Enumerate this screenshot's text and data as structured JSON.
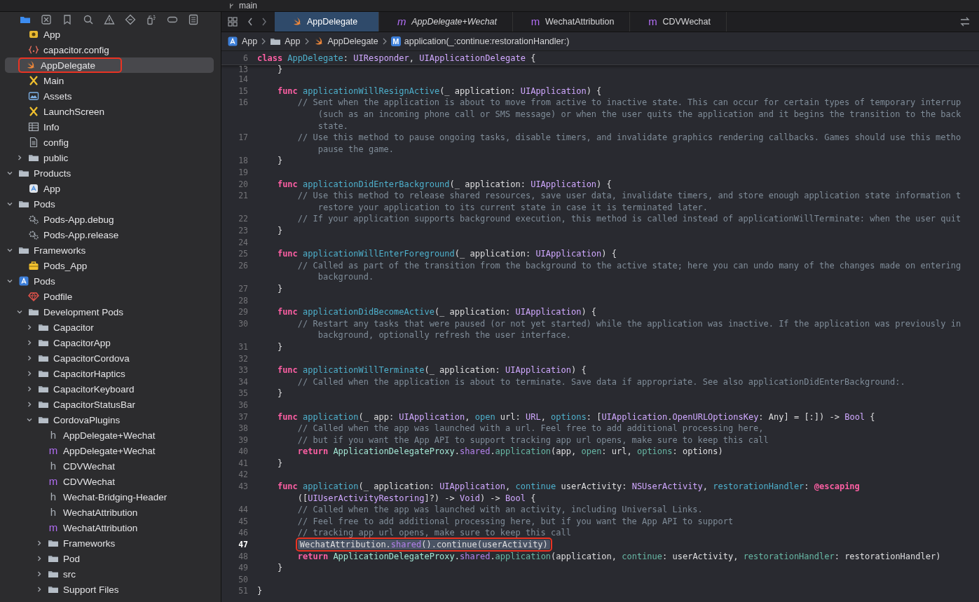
{
  "top_strip": {
    "branch": "main"
  },
  "navigator_tabs": [
    {
      "kind": "folder",
      "selected": true
    },
    {
      "kind": "square-x",
      "selected": false
    },
    {
      "kind": "bookmark",
      "selected": false
    },
    {
      "kind": "search",
      "selected": false
    },
    {
      "kind": "warning",
      "selected": false
    },
    {
      "kind": "diamond",
      "selected": false
    },
    {
      "kind": "spray",
      "selected": false
    },
    {
      "kind": "capsule",
      "selected": false
    },
    {
      "kind": "list",
      "selected": false
    }
  ],
  "tree": [
    {
      "children": [
        {
          "children": [
            {
              "label": "App",
              "kind": "appgroup",
              "selected": false,
              "marked": false
            },
            {
              "label": "capacitor.config",
              "kind": "config",
              "selected": false,
              "marked": false
            },
            {
              "label": "AppDelegate",
              "kind": "swift",
              "selected": true,
              "marked": true
            },
            {
              "label": "Main",
              "kind": "storyboard",
              "selected": false,
              "marked": false
            },
            {
              "label": "Assets",
              "kind": "assets",
              "selected": false,
              "marked": false
            },
            {
              "label": "LaunchScreen",
              "kind": "storyboard",
              "selected": false,
              "marked": false
            },
            {
              "label": "Info",
              "kind": "plist",
              "selected": false,
              "marked": false
            },
            {
              "label": "config",
              "kind": "file",
              "selected": false,
              "marked": false
            },
            {
              "label": "public",
              "kind": "folder",
              "expanded": false,
              "selected": false,
              "marked": false
            }
          ]
        },
        {
          "label": "Products",
          "kind": "folder",
          "expanded": true,
          "selected": false,
          "marked": false,
          "children": [
            {
              "label": "App",
              "kind": "app",
              "selected": false,
              "marked": false
            }
          ]
        },
        {
          "label": "Pods",
          "kind": "folder",
          "expanded": true,
          "selected": false,
          "marked": false,
          "children": [
            {
              "label": "Pods-App.debug",
              "kind": "xcconfig",
              "selected": false,
              "marked": false
            },
            {
              "label": "Pods-App.release",
              "kind": "xcconfig",
              "selected": false,
              "marked": false
            }
          ]
        },
        {
          "label": "Frameworks",
          "kind": "folder",
          "expanded": true,
          "selected": false,
          "marked": false,
          "children": [
            {
              "label": "Pods_App",
              "kind": "framework",
              "selected": false,
              "marked": false
            }
          ]
        }
      ]
    },
    {
      "label": "Pods",
      "kind": "project",
      "expanded": true,
      "selected": false,
      "marked": false,
      "children": [
        {
          "label": "Podfile",
          "kind": "gem",
          "selected": false,
          "marked": false
        },
        {
          "label": "Development Pods",
          "kind": "folder",
          "expanded": true,
          "selected": false,
          "marked": false,
          "children": [
            {
              "label": "Capacitor",
              "kind": "folder",
              "expanded": false,
              "selected": false,
              "marked": false
            },
            {
              "label": "CapacitorApp",
              "kind": "folder",
              "expanded": false,
              "selected": false,
              "marked": false
            },
            {
              "label": "CapacitorCordova",
              "kind": "folder",
              "expanded": false,
              "selected": false,
              "marked": false
            },
            {
              "label": "CapacitorHaptics",
              "kind": "folder",
              "expanded": false,
              "selected": false,
              "marked": false
            },
            {
              "label": "CapacitorKeyboard",
              "kind": "folder",
              "expanded": false,
              "selected": false,
              "marked": false
            },
            {
              "label": "CapacitorStatusBar",
              "kind": "folder",
              "expanded": false,
              "selected": false,
              "marked": false
            },
            {
              "label": "CordovaPlugins",
              "kind": "folder",
              "expanded": true,
              "selected": false,
              "marked": false,
              "children": [
                {
                  "label": "AppDelegate+Wechat",
                  "kind": "header",
                  "badge": "h",
                  "selected": false,
                  "marked": false
                },
                {
                  "label": "AppDelegate+Wechat",
                  "kind": "source",
                  "badge": "m",
                  "selected": false,
                  "marked": false
                },
                {
                  "label": "CDVWechat",
                  "kind": "header",
                  "badge": "h",
                  "selected": false,
                  "marked": false
                },
                {
                  "label": "CDVWechat",
                  "kind": "source",
                  "badge": "m",
                  "selected": false,
                  "marked": false
                },
                {
                  "label": "Wechat-Bridging-Header",
                  "kind": "header",
                  "badge": "h",
                  "selected": false,
                  "marked": false
                },
                {
                  "label": "WechatAttribution",
                  "kind": "header",
                  "badge": "h",
                  "selected": false,
                  "marked": false
                },
                {
                  "label": "WechatAttribution",
                  "kind": "source",
                  "badge": "m",
                  "selected": false,
                  "marked": false
                },
                {
                  "label": "Frameworks",
                  "kind": "folder",
                  "expanded": false,
                  "selected": false,
                  "marked": false
                },
                {
                  "label": "Pod",
                  "kind": "folder",
                  "expanded": false,
                  "selected": false,
                  "marked": false
                },
                {
                  "label": "src",
                  "kind": "folder",
                  "expanded": false,
                  "selected": false,
                  "marked": false
                },
                {
                  "label": "Support Files",
                  "kind": "folder",
                  "expanded": false,
                  "selected": false,
                  "marked": false
                }
              ]
            }
          ]
        }
      ]
    }
  ],
  "tabs": [
    {
      "label": "AppDelegate",
      "kind": "swift",
      "selected": true,
      "preview": false
    },
    {
      "label": "AppDelegate+Wechat",
      "kind": "source",
      "badge": "m",
      "selected": false,
      "preview": true
    },
    {
      "label": "WechatAttribution",
      "kind": "source",
      "badge": "m",
      "selected": false,
      "preview": false
    },
    {
      "label": "CDVWechat",
      "kind": "source",
      "badge": "m",
      "selected": false,
      "preview": false
    }
  ],
  "breadcrumb": [
    {
      "label": "App",
      "kind": "project"
    },
    {
      "label": "App",
      "kind": "folder"
    },
    {
      "label": "AppDelegate",
      "kind": "swift"
    },
    {
      "label": "application(_:continue:restorationHandler:)",
      "kind": "method",
      "badge": "M"
    }
  ],
  "sticky_header": {
    "number": "6",
    "rows": [
      [
        {
          "kind": "keyword",
          "text": "class"
        },
        {
          "kind": "plain",
          "text": " "
        },
        {
          "kind": "decl",
          "text": "AppDelegate"
        },
        {
          "kind": "plain",
          "text": ": "
        },
        {
          "kind": "type",
          "text": "UIResponder"
        },
        {
          "kind": "plain",
          "text": ", "
        },
        {
          "kind": "type",
          "text": "UIApplicationDelegate"
        },
        {
          "kind": "plain",
          "text": " {"
        }
      ]
    ]
  },
  "code": [
    {
      "number": "13",
      "selected": false,
      "marked": false,
      "rows": [
        [
          {
            "kind": "plain",
            "text": "    }"
          }
        ]
      ]
    },
    {
      "number": "14",
      "selected": false,
      "marked": false
    },
    {
      "number": "15",
      "selected": false,
      "marked": false,
      "rows": [
        [
          {
            "kind": "keyword",
            "text": "    func"
          },
          {
            "kind": "plain",
            "text": " "
          },
          {
            "kind": "decl",
            "text": "applicationWillResignActive"
          },
          {
            "kind": "plain",
            "text": "(_ application: "
          },
          {
            "kind": "type",
            "text": "UIApplication"
          },
          {
            "kind": "plain",
            "text": ") {"
          }
        ]
      ]
    },
    {
      "number": "16",
      "selected": false,
      "marked": false,
      "rows": [
        [
          {
            "kind": "comment",
            "text": "        // Sent when the application is about to move from active to inactive state. This can occur for certain types of temporary interrup"
          }
        ],
        [
          {
            "kind": "comment",
            "text": "            (such as an incoming phone call or SMS message) or when the user quits the application and it begins the transition to the back"
          }
        ],
        [
          {
            "kind": "comment",
            "text": "            state."
          }
        ]
      ]
    },
    {
      "number": "17",
      "selected": false,
      "marked": false,
      "rows": [
        [
          {
            "kind": "comment",
            "text": "        // Use this method to pause ongoing tasks, disable timers, and invalidate graphics rendering callbacks. Games should use this metho"
          }
        ],
        [
          {
            "kind": "comment",
            "text": "            pause the game."
          }
        ]
      ]
    },
    {
      "number": "18",
      "selected": false,
      "marked": false,
      "rows": [
        [
          {
            "kind": "plain",
            "text": "    }"
          }
        ]
      ]
    },
    {
      "number": "19",
      "selected": false,
      "marked": false
    },
    {
      "number": "20",
      "selected": false,
      "marked": false,
      "rows": [
        [
          {
            "kind": "keyword",
            "text": "    func"
          },
          {
            "kind": "plain",
            "text": " "
          },
          {
            "kind": "decl",
            "text": "applicationDidEnterBackground"
          },
          {
            "kind": "plain",
            "text": "(_ application: "
          },
          {
            "kind": "type",
            "text": "UIApplication"
          },
          {
            "kind": "plain",
            "text": ") {"
          }
        ]
      ]
    },
    {
      "number": "21",
      "selected": false,
      "marked": false,
      "rows": [
        [
          {
            "kind": "comment",
            "text": "        // Use this method to release shared resources, save user data, invalidate timers, and store enough application state information t"
          }
        ],
        [
          {
            "kind": "comment",
            "text": "            restore your application to its current state in case it is terminated later."
          }
        ]
      ]
    },
    {
      "number": "22",
      "selected": false,
      "marked": false,
      "rows": [
        [
          {
            "kind": "comment",
            "text": "        // If your application supports background execution, this method is called instead of applicationWillTerminate: when the user quit"
          }
        ]
      ]
    },
    {
      "number": "23",
      "selected": false,
      "marked": false,
      "rows": [
        [
          {
            "kind": "plain",
            "text": "    }"
          }
        ]
      ]
    },
    {
      "number": "24",
      "selected": false,
      "marked": false
    },
    {
      "number": "25",
      "selected": false,
      "marked": false,
      "rows": [
        [
          {
            "kind": "keyword",
            "text": "    func"
          },
          {
            "kind": "plain",
            "text": " "
          },
          {
            "kind": "decl",
            "text": "applicationWillEnterForeground"
          },
          {
            "kind": "plain",
            "text": "(_ application: "
          },
          {
            "kind": "type",
            "text": "UIApplication"
          },
          {
            "kind": "plain",
            "text": ") {"
          }
        ]
      ]
    },
    {
      "number": "26",
      "selected": false,
      "marked": false,
      "rows": [
        [
          {
            "kind": "comment",
            "text": "        // Called as part of the transition from the background to the active state; here you can undo many of the changes made on entering"
          }
        ],
        [
          {
            "kind": "comment",
            "text": "            background."
          }
        ]
      ]
    },
    {
      "number": "27",
      "selected": false,
      "marked": false,
      "rows": [
        [
          {
            "kind": "plain",
            "text": "    }"
          }
        ]
      ]
    },
    {
      "number": "28",
      "selected": false,
      "marked": false
    },
    {
      "number": "29",
      "selected": false,
      "marked": false,
      "rows": [
        [
          {
            "kind": "keyword",
            "text": "    func"
          },
          {
            "kind": "plain",
            "text": " "
          },
          {
            "kind": "decl",
            "text": "applicationDidBecomeActive"
          },
          {
            "kind": "plain",
            "text": "(_ application: "
          },
          {
            "kind": "type",
            "text": "UIApplication"
          },
          {
            "kind": "plain",
            "text": ") {"
          }
        ]
      ]
    },
    {
      "number": "30",
      "selected": false,
      "marked": false,
      "rows": [
        [
          {
            "kind": "comment",
            "text": "        // Restart any tasks that were paused (or not yet started) while the application was inactive. If the application was previously in"
          }
        ],
        [
          {
            "kind": "comment",
            "text": "            background, optionally refresh the user interface."
          }
        ]
      ]
    },
    {
      "number": "31",
      "selected": false,
      "marked": false,
      "rows": [
        [
          {
            "kind": "plain",
            "text": "    }"
          }
        ]
      ]
    },
    {
      "number": "32",
      "selected": false,
      "marked": false
    },
    {
      "number": "33",
      "selected": false,
      "marked": false,
      "rows": [
        [
          {
            "kind": "keyword",
            "text": "    func"
          },
          {
            "kind": "plain",
            "text": " "
          },
          {
            "kind": "decl",
            "text": "applicationWillTerminate"
          },
          {
            "kind": "plain",
            "text": "(_ application: "
          },
          {
            "kind": "type",
            "text": "UIApplication"
          },
          {
            "kind": "plain",
            "text": ") {"
          }
        ]
      ]
    },
    {
      "number": "34",
      "selected": false,
      "marked": false,
      "rows": [
        [
          {
            "kind": "comment",
            "text": "        // Called when the application is about to terminate. Save data if appropriate. See also applicationDidEnterBackground:."
          }
        ]
      ]
    },
    {
      "number": "35",
      "selected": false,
      "marked": false,
      "rows": [
        [
          {
            "kind": "plain",
            "text": "    }"
          }
        ]
      ]
    },
    {
      "number": "36",
      "selected": false,
      "marked": false
    },
    {
      "number": "37",
      "selected": false,
      "marked": false,
      "rows": [
        [
          {
            "kind": "keyword",
            "text": "    func"
          },
          {
            "kind": "plain",
            "text": " "
          },
          {
            "kind": "decl",
            "text": "application"
          },
          {
            "kind": "plain",
            "text": "(_ app: "
          },
          {
            "kind": "type",
            "text": "UIApplication"
          },
          {
            "kind": "plain",
            "text": ", "
          },
          {
            "kind": "decl",
            "text": "open"
          },
          {
            "kind": "plain",
            "text": " url: "
          },
          {
            "kind": "type",
            "text": "URL"
          },
          {
            "kind": "plain",
            "text": ", "
          },
          {
            "kind": "decl",
            "text": "options"
          },
          {
            "kind": "plain",
            "text": ": ["
          },
          {
            "kind": "type",
            "text": "UIApplication"
          },
          {
            "kind": "plain",
            "text": "."
          },
          {
            "kind": "type",
            "text": "OpenURLOptionsKey"
          },
          {
            "kind": "plain",
            "text": ": Any] = [:]) -> "
          },
          {
            "kind": "type",
            "text": "Bool"
          },
          {
            "kind": "plain",
            "text": " {"
          }
        ]
      ]
    },
    {
      "number": "38",
      "selected": false,
      "marked": false,
      "rows": [
        [
          {
            "kind": "comment",
            "text": "        // Called when the app was launched with a url. Feel free to add additional processing here,"
          }
        ]
      ]
    },
    {
      "number": "39",
      "selected": false,
      "marked": false,
      "rows": [
        [
          {
            "kind": "comment",
            "text": "        // but if you want the App API to support tracking app url opens, make sure to keep this call"
          }
        ]
      ]
    },
    {
      "number": "40",
      "selected": false,
      "marked": false,
      "rows": [
        [
          {
            "kind": "keyword",
            "text": "        return"
          },
          {
            "kind": "plain",
            "text": " "
          },
          {
            "kind": "class",
            "text": "ApplicationDelegateProxy"
          },
          {
            "kind": "plain",
            "text": "."
          },
          {
            "kind": "member",
            "text": "shared"
          },
          {
            "kind": "plain",
            "text": "."
          },
          {
            "kind": "arg",
            "text": "application"
          },
          {
            "kind": "plain",
            "text": "(app, "
          },
          {
            "kind": "arg",
            "text": "open"
          },
          {
            "kind": "plain",
            "text": ": url, "
          },
          {
            "kind": "arg",
            "text": "options"
          },
          {
            "kind": "plain",
            "text": ": options)"
          }
        ]
      ]
    },
    {
      "number": "41",
      "selected": false,
      "marked": false,
      "rows": [
        [
          {
            "kind": "plain",
            "text": "    }"
          }
        ]
      ]
    },
    {
      "number": "42",
      "selected": false,
      "marked": false
    },
    {
      "number": "43",
      "selected": false,
      "marked": false,
      "rows": [
        [
          {
            "kind": "keyword",
            "text": "    func"
          },
          {
            "kind": "plain",
            "text": " "
          },
          {
            "kind": "decl",
            "text": "application"
          },
          {
            "kind": "plain",
            "text": "(_ application: "
          },
          {
            "kind": "type",
            "text": "UIApplication"
          },
          {
            "kind": "plain",
            "text": ", "
          },
          {
            "kind": "decl",
            "text": "continue"
          },
          {
            "kind": "plain",
            "text": " userActivity: "
          },
          {
            "kind": "type",
            "text": "NSUserActivity"
          },
          {
            "kind": "plain",
            "text": ", "
          },
          {
            "kind": "decl",
            "text": "restorationHandler"
          },
          {
            "kind": "plain",
            "text": ": "
          },
          {
            "kind": "keyword",
            "text": "@escaping"
          },
          {
            "kind": "break"
          },
          {
            "kind": "plain",
            "text": "        (["
          },
          {
            "kind": "type",
            "text": "UIUserActivityRestoring"
          },
          {
            "kind": "plain",
            "text": "]?) -> "
          },
          {
            "kind": "type",
            "text": "Void"
          },
          {
            "kind": "plain",
            "text": ") -> "
          },
          {
            "kind": "type",
            "text": "Bool"
          },
          {
            "kind": "plain",
            "text": " {"
          }
        ]
      ]
    },
    {
      "number": "44",
      "selected": false,
      "marked": false,
      "rows": [
        [
          {
            "kind": "comment",
            "text": "        // Called when the app was launched with an activity, including Universal Links."
          }
        ]
      ]
    },
    {
      "number": "45",
      "selected": false,
      "marked": false,
      "rows": [
        [
          {
            "kind": "comment",
            "text": "        // Feel free to add additional processing here, but if you want the App API to support"
          }
        ]
      ]
    },
    {
      "number": "46",
      "selected": false,
      "marked": false,
      "rows": [
        [
          {
            "kind": "comment",
            "text": "        // tracking app url opens, make sure to keep this call"
          }
        ]
      ]
    },
    {
      "number": "47",
      "selected": true,
      "marked": true,
      "rows": [
        [
          {
            "kind": "plain",
            "text": "        WechatAttribution."
          },
          {
            "kind": "member",
            "text": "shared"
          },
          {
            "kind": "plain",
            "text": "().continue(userActivity)"
          }
        ]
      ]
    },
    {
      "number": "48",
      "selected": false,
      "marked": false,
      "rows": [
        [
          {
            "kind": "keyword",
            "text": "        return"
          },
          {
            "kind": "plain",
            "text": " "
          },
          {
            "kind": "class",
            "text": "ApplicationDelegateProxy"
          },
          {
            "kind": "plain",
            "text": "."
          },
          {
            "kind": "member",
            "text": "shared"
          },
          {
            "kind": "plain",
            "text": "."
          },
          {
            "kind": "arg",
            "text": "application"
          },
          {
            "kind": "plain",
            "text": "(application, "
          },
          {
            "kind": "arg",
            "text": "continue"
          },
          {
            "kind": "plain",
            "text": ": userActivity, "
          },
          {
            "kind": "arg",
            "text": "restorationHandler"
          },
          {
            "kind": "plain",
            "text": ": restorationHandler)"
          }
        ]
      ]
    },
    {
      "number": "49",
      "selected": false,
      "marked": false,
      "rows": [
        [
          {
            "kind": "plain",
            "text": "    }"
          }
        ]
      ]
    },
    {
      "number": "50",
      "selected": false,
      "marked": false
    },
    {
      "number": "51",
      "selected": false,
      "marked": false,
      "rows": [
        [
          {
            "kind": "plain",
            "text": "}"
          }
        ]
      ]
    }
  ]
}
